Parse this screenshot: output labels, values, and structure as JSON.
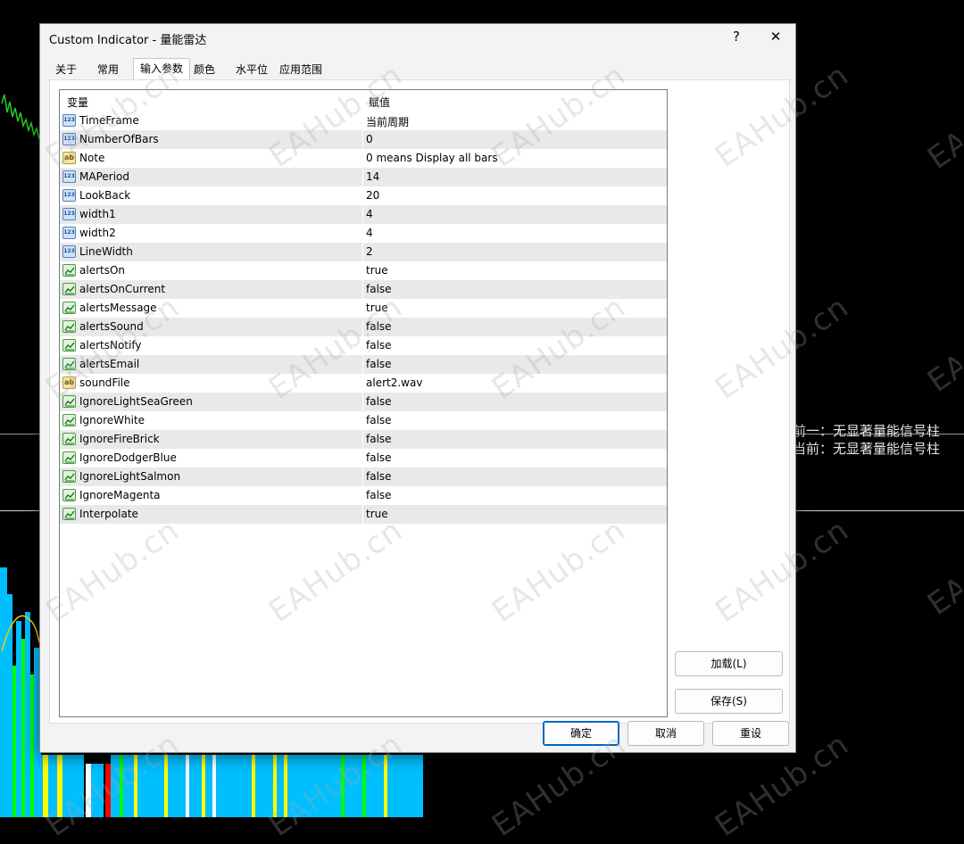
{
  "window": {
    "title": "Custom Indicator - 量能雷达",
    "help_label": "?",
    "close_label": "✕"
  },
  "tabs": [
    "关于",
    "常用",
    "输入参数",
    "颜色",
    "水平位",
    "应用范围"
  ],
  "active_tab": "输入参数",
  "grid": {
    "col_variable": "变量",
    "col_value": "赋值",
    "rows": [
      {
        "type": "num",
        "name": "TimeFrame",
        "value": "当前周期"
      },
      {
        "type": "num",
        "name": "NumberOfBars",
        "value": "0"
      },
      {
        "type": "str",
        "name": "Note",
        "value": "0 means Display all bars"
      },
      {
        "type": "num",
        "name": "MAPeriod",
        "value": "14"
      },
      {
        "type": "num",
        "name": "LookBack",
        "value": "20"
      },
      {
        "type": "num",
        "name": "width1",
        "value": "4"
      },
      {
        "type": "num",
        "name": "width2",
        "value": "4"
      },
      {
        "type": "num",
        "name": "LineWidth",
        "value": "2"
      },
      {
        "type": "bool",
        "name": "alertsOn",
        "value": "true"
      },
      {
        "type": "bool",
        "name": "alertsOnCurrent",
        "value": "false"
      },
      {
        "type": "bool",
        "name": "alertsMessage",
        "value": "true"
      },
      {
        "type": "bool",
        "name": "alertsSound",
        "value": "false"
      },
      {
        "type": "bool",
        "name": "alertsNotify",
        "value": "false"
      },
      {
        "type": "bool",
        "name": "alertsEmail",
        "value": "false"
      },
      {
        "type": "str",
        "name": "soundFile",
        "value": "alert2.wav"
      },
      {
        "type": "bool",
        "name": "IgnoreLightSeaGreen",
        "value": "false"
      },
      {
        "type": "bool",
        "name": "IgnoreWhite",
        "value": "false"
      },
      {
        "type": "bool",
        "name": "IgnoreFireBrick",
        "value": "false"
      },
      {
        "type": "bool",
        "name": "IgnoreDodgerBlue",
        "value": "false"
      },
      {
        "type": "bool",
        "name": "IgnoreLightSalmon",
        "value": "false"
      },
      {
        "type": "bool",
        "name": "IgnoreMagenta",
        "value": "false"
      },
      {
        "type": "bool",
        "name": "Interpolate",
        "value": "true"
      }
    ]
  },
  "buttons": {
    "load": "加载(L)",
    "save": "保存(S)",
    "ok": "确定",
    "cancel": "取消",
    "reset": "重设"
  },
  "background": {
    "label1": "前一：无显著量能信号柱",
    "label2": "当前：无显著量能信号柱",
    "watermark": "EAHub.cn"
  },
  "colors": {
    "chart_bg": "#000000",
    "bar_blue": "#00bfff",
    "bar_green": "#00ff00",
    "bar_yellow": "#ffff00",
    "bar_red": "#ff0000",
    "bar_white": "#ffffff",
    "accent": "#0067c0"
  }
}
